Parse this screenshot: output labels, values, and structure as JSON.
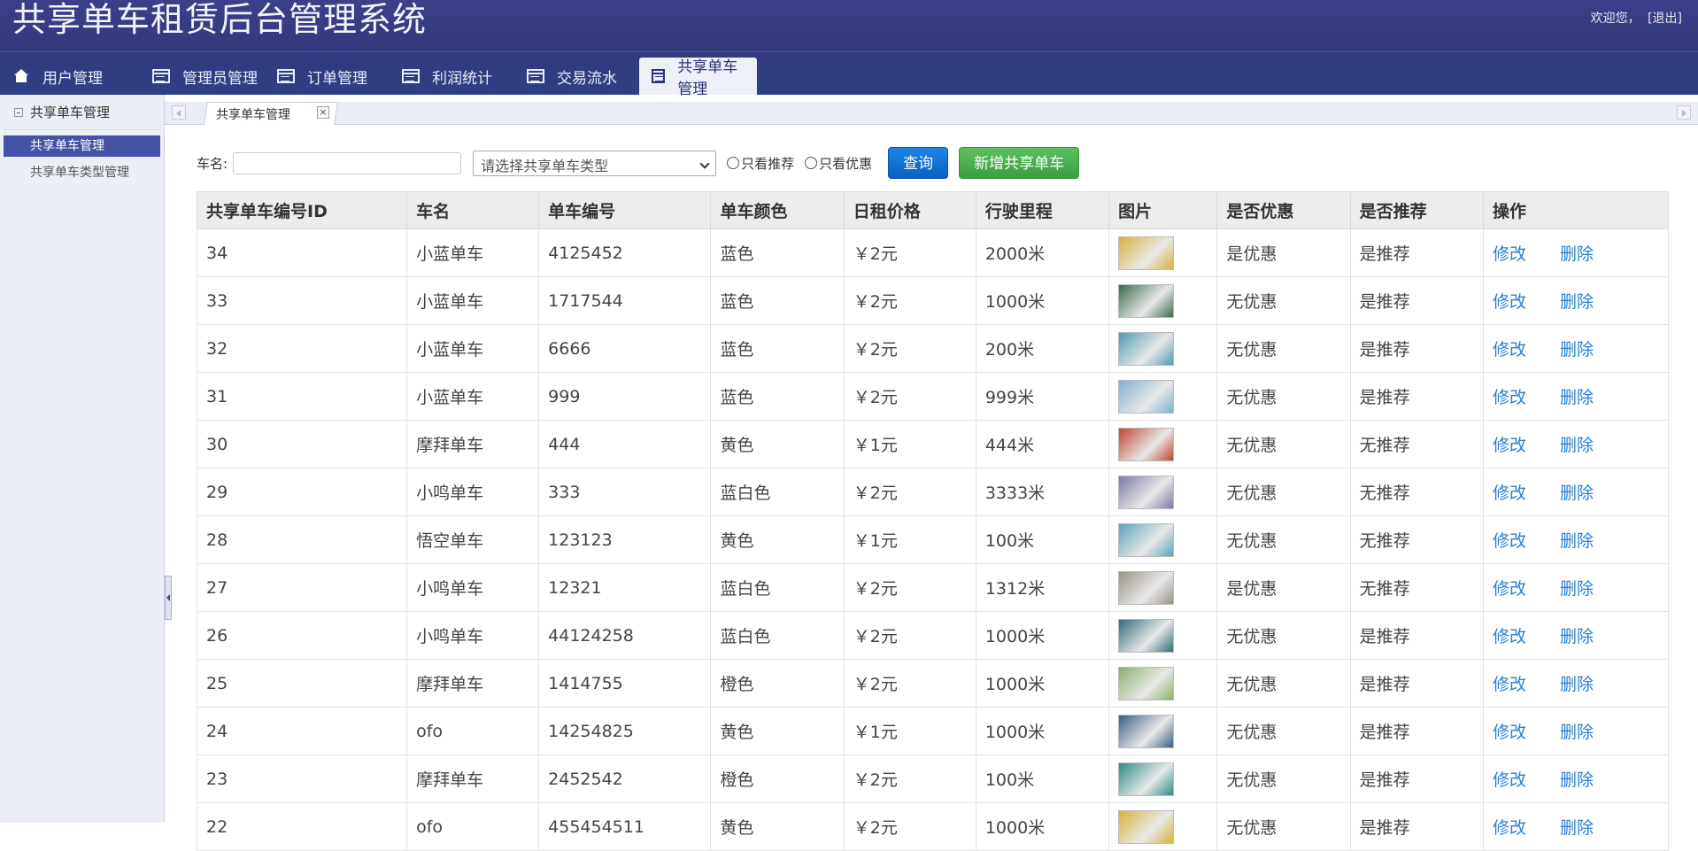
{
  "app": {
    "title": "共享单车租赁后台管理系统",
    "welcome": "欢迎您，",
    "logout": "[退出]"
  },
  "nav": [
    {
      "label": "用户管理",
      "icon": "home-icon"
    },
    {
      "label": "管理员管理",
      "icon": "window-icon"
    },
    {
      "label": "订单管理",
      "icon": "window-icon"
    },
    {
      "label": "利润统计",
      "icon": "window-icon"
    },
    {
      "label": "交易流水",
      "icon": "window-icon"
    },
    {
      "label": "共享单车管理",
      "icon": "window-icon",
      "active": true
    }
  ],
  "sidebar": {
    "heading": "共享单车管理",
    "items": [
      {
        "label": "共享单车管理",
        "active": true
      },
      {
        "label": "共享单车类型管理"
      }
    ]
  },
  "tabs": {
    "current": "共享单车管理"
  },
  "filter": {
    "name_label": "车名:",
    "name_value": "",
    "type_select": "请选择共享单车类型",
    "only_recommend": "只看推荐",
    "only_discount": "只看优惠",
    "query": "查询",
    "add": "新增共享单车"
  },
  "table": {
    "headers": [
      "共享单车编号ID",
      "车名",
      "单车编号",
      "单车颜色",
      "日租价格",
      "行驶里程",
      "图片",
      "是否优惠",
      "是否推荐",
      "操作"
    ],
    "edit_label": "修改",
    "delete_label": "删除",
    "rows": [
      {
        "id": "34",
        "name": "小蓝单车",
        "code": "4125452",
        "color": "蓝色",
        "price": "￥2元",
        "mileage": "2000米",
        "img": "#d9b03c",
        "discount": "是优惠",
        "recommend": "是推荐"
      },
      {
        "id": "33",
        "name": "小蓝单车",
        "code": "1717544",
        "color": "蓝色",
        "price": "￥2元",
        "mileage": "1000米",
        "img": "#3a6a48",
        "discount": "无优惠",
        "recommend": "是推荐"
      },
      {
        "id": "32",
        "name": "小蓝单车",
        "code": "6666",
        "color": "蓝色",
        "price": "￥2元",
        "mileage": "200米",
        "img": "#4f9bb2",
        "discount": "无优惠",
        "recommend": "是推荐"
      },
      {
        "id": "31",
        "name": "小蓝单车",
        "code": "999",
        "color": "蓝色",
        "price": "￥2元",
        "mileage": "999米",
        "img": "#7fb0d0",
        "discount": "无优惠",
        "recommend": "是推荐"
      },
      {
        "id": "30",
        "name": "摩拜单车",
        "code": "444",
        "color": "黄色",
        "price": "￥1元",
        "mileage": "444米",
        "img": "#c0452f",
        "discount": "无优惠",
        "recommend": "无推荐"
      },
      {
        "id": "29",
        "name": "小鸣单车",
        "code": "333",
        "color": "蓝白色",
        "price": "￥2元",
        "mileage": "3333米",
        "img": "#7c7aa4",
        "discount": "无优惠",
        "recommend": "无推荐"
      },
      {
        "id": "28",
        "name": "悟空单车",
        "code": "123123",
        "color": "黄色",
        "price": "￥1元",
        "mileage": "100米",
        "img": "#5aa4b6",
        "discount": "无优惠",
        "recommend": "无推荐"
      },
      {
        "id": "27",
        "name": "小鸣单车",
        "code": "12321",
        "color": "蓝白色",
        "price": "￥2元",
        "mileage": "1312米",
        "img": "#9a9486",
        "discount": "是优惠",
        "recommend": "无推荐"
      },
      {
        "id": "26",
        "name": "小鸣单车",
        "code": "44124258",
        "color": "蓝白色",
        "price": "￥2元",
        "mileage": "1000米",
        "img": "#2f6d78",
        "discount": "无优惠",
        "recommend": "是推荐"
      },
      {
        "id": "25",
        "name": "摩拜单车",
        "code": "1414755",
        "color": "橙色",
        "price": "￥2元",
        "mileage": "1000米",
        "img": "#8ab06a",
        "discount": "无优惠",
        "recommend": "是推荐"
      },
      {
        "id": "24",
        "name": "ofo",
        "code": "14254825",
        "color": "黄色",
        "price": "￥1元",
        "mileage": "1000米",
        "img": "#3c5c82",
        "discount": "无优惠",
        "recommend": "是推荐"
      },
      {
        "id": "23",
        "name": "摩拜单车",
        "code": "2452542",
        "color": "橙色",
        "price": "￥2元",
        "mileage": "100米",
        "img": "#2d8a86",
        "discount": "无优惠",
        "recommend": "是推荐"
      },
      {
        "id": "22",
        "name": "ofo",
        "code": "455454511",
        "color": "黄色",
        "price": "￥2元",
        "mileage": "1000米",
        "img": "#d4b33a",
        "discount": "无优惠",
        "recommend": "是推荐"
      }
    ]
  }
}
